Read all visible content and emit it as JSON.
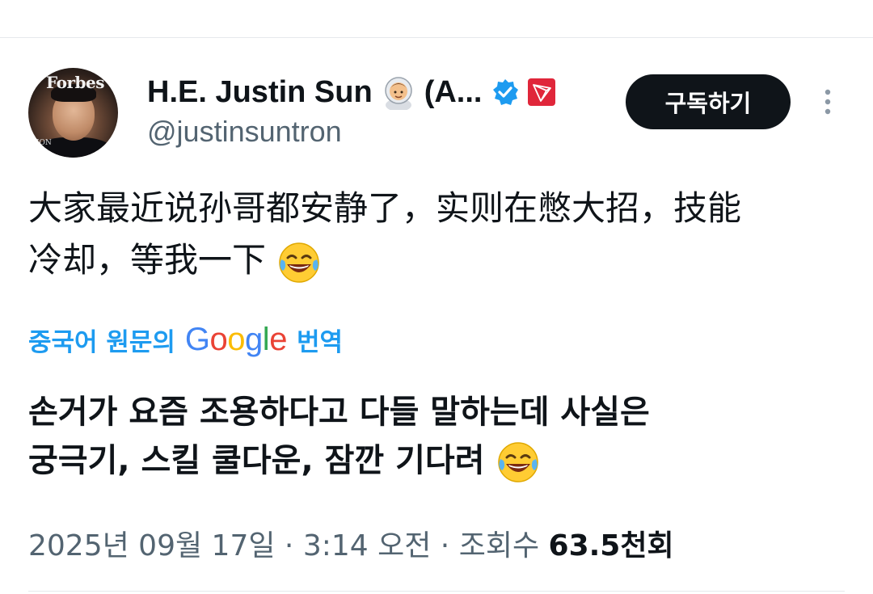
{
  "header": {
    "display_name": "H.E. Justin Sun",
    "name_suffix": "(A...",
    "handle": "@justinsuntron",
    "avatar_text": "Forbes",
    "avatar_corner_text": "TION",
    "subscribe_label": "구독하기",
    "icons": [
      "astronaut-emoji",
      "verified-badge-icon",
      "tron-logo-icon",
      "more-vertical-icon"
    ],
    "colors": {
      "verified": "#1d9bf0",
      "tron": "#e0263a",
      "button": "#0f1419"
    }
  },
  "tweet": {
    "text_line1": "大家最近说孙哥都安静了，实则在憋大招，技能",
    "text_line2": "冷却，等我一下",
    "emoji": "face-with-tears-of-joy"
  },
  "translation": {
    "prefix": "중국어 원문의",
    "brand": "Google",
    "suffix": "번역",
    "text_line1": "손거가 요즘 조용하다고 다들 말하는데 사실은",
    "text_line2": "궁극기, 스킬 쿨다운, 잠깐 기다려",
    "link_color": "#1d9bf0"
  },
  "meta": {
    "date": "2025년 09월 17일",
    "sep1": " · ",
    "time": "3:14 오전",
    "sep2": " · ",
    "views_label": "조회수",
    "views_value": "63.5천회"
  }
}
